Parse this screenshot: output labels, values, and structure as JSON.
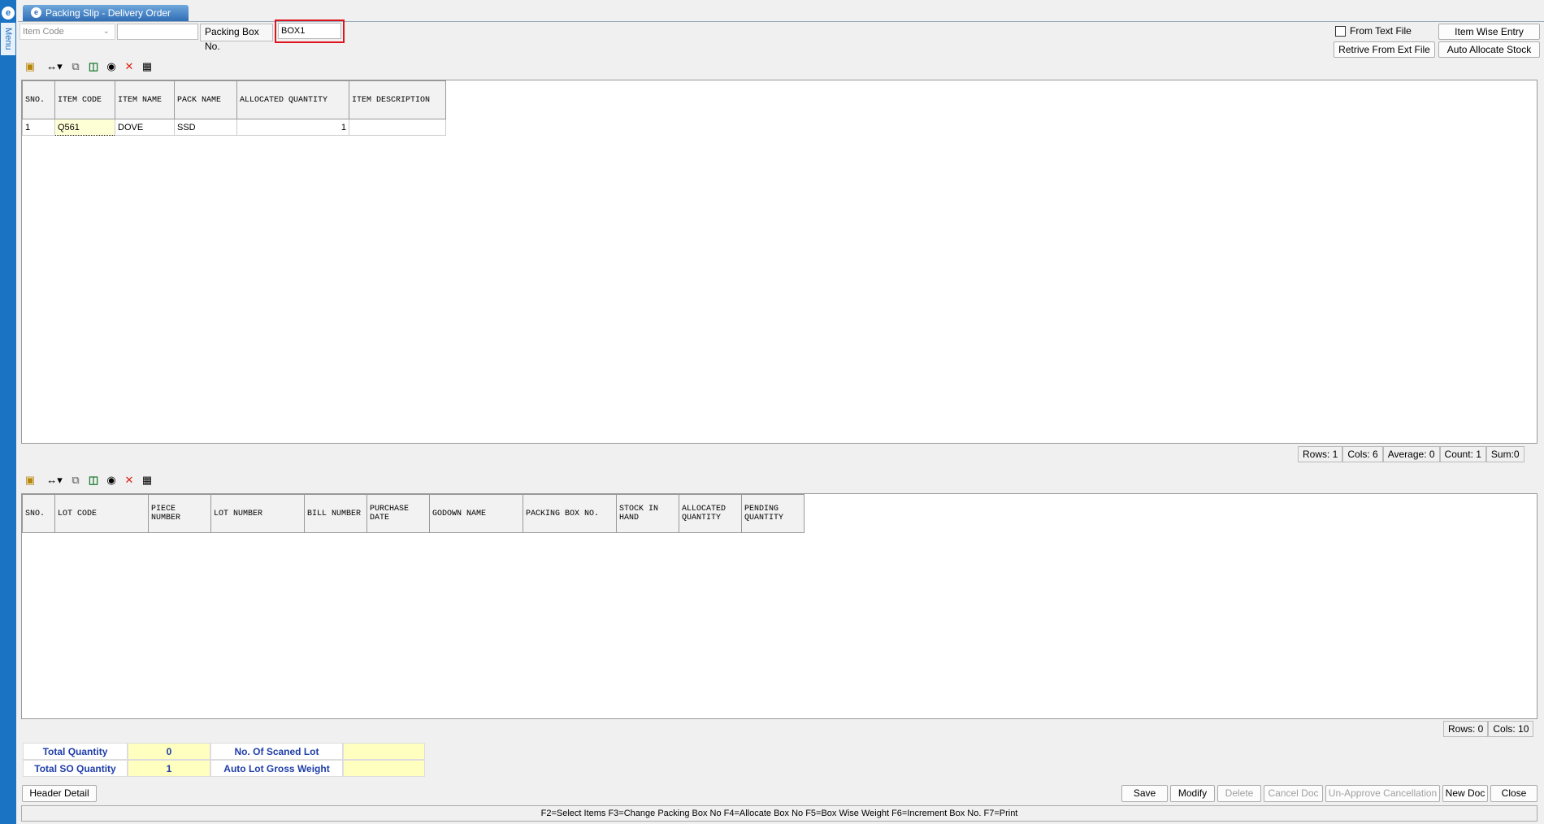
{
  "window": {
    "tab_title": "Packing Slip - Delivery Order",
    "menu_label": "Menu"
  },
  "top": {
    "item_code_placeholder": "Item Code",
    "packing_box_label": "Packing Box No.",
    "packing_box_value": "BOX1",
    "from_text_file_label": "From Text File",
    "item_wise_entry_label": "Item Wise Entry",
    "retrive_label": "Retrive From Ext File",
    "auto_allocate_label": "Auto Allocate Stock"
  },
  "grid1": {
    "columns": [
      "SNO.",
      "ITEM CODE",
      "ITEM NAME",
      "PACK NAME",
      "ALLOCATED QUANTITY",
      "ITEM DESCRIPTION"
    ],
    "rows": [
      {
        "sno": "1",
        "item_code": "Q561",
        "item_name": "DOVE",
        "pack_name": "SSD",
        "allocated_quantity": "1",
        "item_description": ""
      }
    ],
    "status": {
      "rows": "Rows: 1",
      "cols": "Cols: 6",
      "average": "Average: 0",
      "count": "Count: 1",
      "sum": "Sum:0"
    }
  },
  "grid2": {
    "columns": [
      "SNO.",
      "LOT CODE",
      "PIECE NUMBER",
      "LOT NUMBER",
      "BILL NUMBER",
      "PURCHASE DATE",
      "GODOWN NAME",
      "PACKING BOX NO.",
      "STOCK IN HAND",
      "ALLOCATED QUANTITY",
      "PENDING QUANTITY"
    ],
    "rows": [],
    "status": {
      "rows": "Rows: 0",
      "cols": "Cols: 10"
    }
  },
  "totals": {
    "total_quantity_label": "Total Quantity",
    "total_quantity_value": "0",
    "total_so_quantity_label": "Total SO Quantity",
    "total_so_quantity_value": "1",
    "scanned_lot_label": "No. Of Scaned Lot",
    "scanned_lot_value": "",
    "auto_lot_gross_weight_label": "Auto Lot Gross Weight",
    "auto_lot_gross_weight_value": ""
  },
  "buttons": {
    "header_detail": "Header Detail",
    "save": "Save",
    "modify": "Modify",
    "delete": "Delete",
    "cancel_doc": "Cancel Doc",
    "unapprove": "Un-Approve Cancellation",
    "new_doc": "New Doc",
    "close": "Close"
  },
  "footer_hint": "F2=Select Items  F3=Change Packing Box No  F4=Allocate Box No F5=Box Wise Weight   F6=Increment Box No. F7=Print",
  "colors": {
    "accent": "#1b73c4",
    "highlight_box": "#e0141e",
    "total_value_bg": "#ffffc0",
    "total_label_text": "#1f3ea8"
  },
  "icons": [
    "note-icon",
    "column-resize-icon",
    "copy-icon",
    "excel-icon",
    "find-icon",
    "delete-x-icon",
    "grid-icon"
  ]
}
